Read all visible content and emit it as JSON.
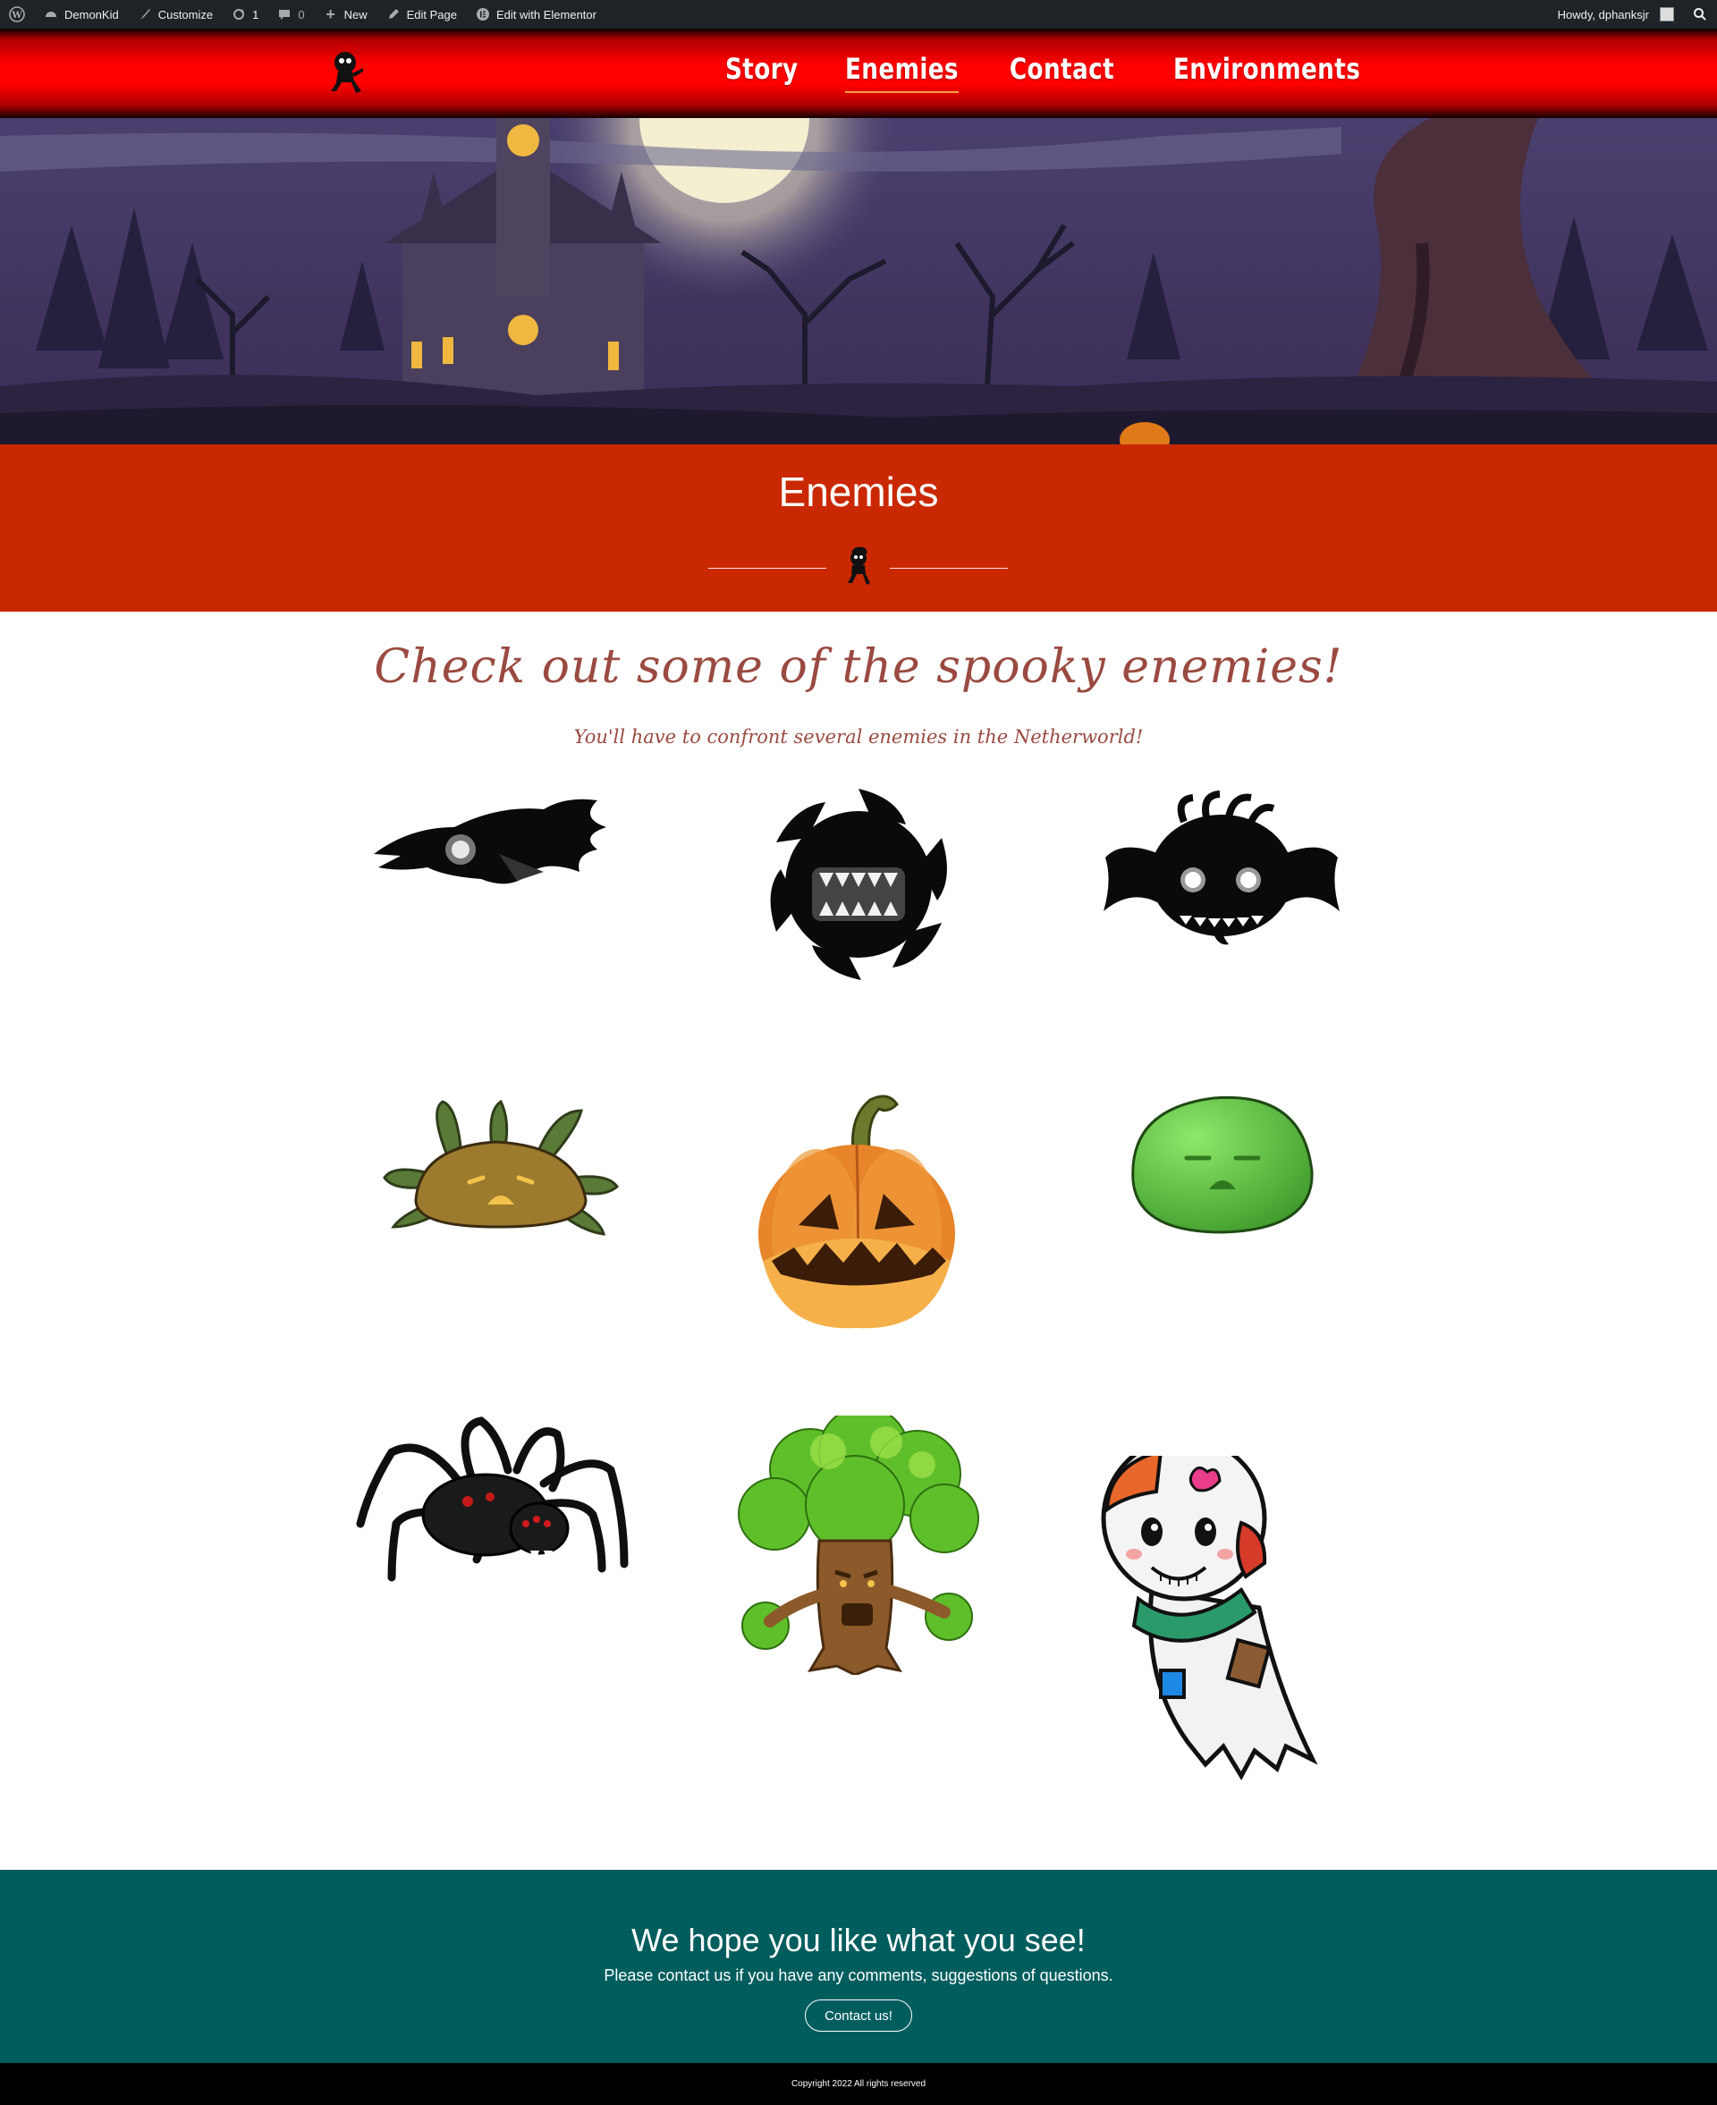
{
  "adminbar": {
    "site_name": "DemonKid",
    "customize": "Customize",
    "updates_count": "1",
    "comments_count": "0",
    "new": "New",
    "edit_page": "Edit Page",
    "edit_elementor": "Edit with Elementor",
    "howdy": "Howdy, dphanksjr"
  },
  "nav": {
    "items": [
      {
        "label": "Story"
      },
      {
        "label": "Enemies"
      },
      {
        "label": "Contact"
      },
      {
        "label": "Environments"
      }
    ],
    "active": "Enemies"
  },
  "page": {
    "title": "Enemies",
    "heading": "Check out some of the spooky enemies!",
    "subheading": "You'll have to confront several enemies in the Netherworld!"
  },
  "enemies": [
    {
      "icon": "crow-enemy-icon"
    },
    {
      "icon": "sawblade-enemy-icon"
    },
    {
      "icon": "bat-enemy-icon"
    },
    {
      "icon": "mud-slime-enemy-icon"
    },
    {
      "icon": "pumpkin-enemy-icon"
    },
    {
      "icon": "green-slime-enemy-icon"
    },
    {
      "icon": "spider-enemy-icon"
    },
    {
      "icon": "tree-enemy-icon"
    },
    {
      "icon": "ghost-enemy-icon"
    }
  ],
  "cta": {
    "title": "We hope you like what you see!",
    "text": "Please contact us if you have any comments, suggestions of questions.",
    "button": "Contact us!"
  },
  "footer": {
    "copyright": "Copyright 2022 All rights reserved"
  },
  "colors": {
    "adminbar": "#1d2327",
    "header_red": "#ff0000",
    "title_band": "#c92800",
    "heading_text": "#9a4a40",
    "cta_teal": "#005d5e",
    "nav_underline": "#f4a340"
  }
}
